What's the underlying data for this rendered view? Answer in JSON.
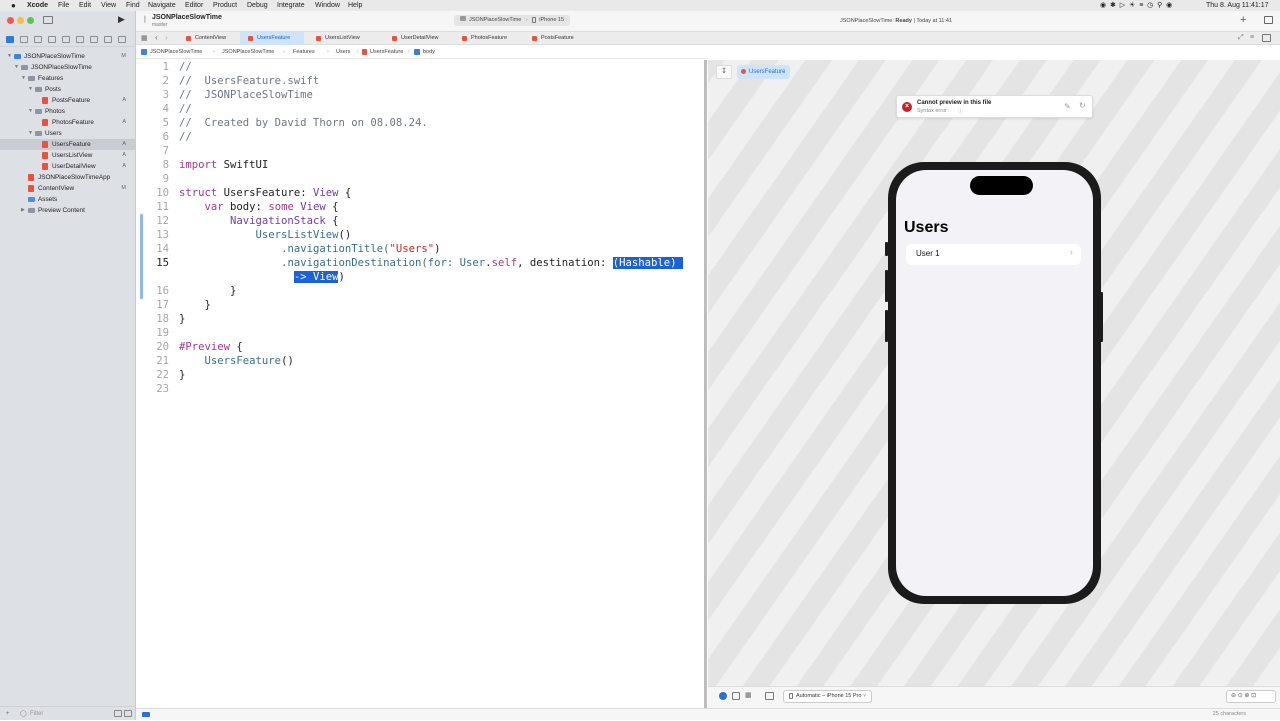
{
  "menubar": {
    "app": "Xcode",
    "items": [
      "File",
      "Edit",
      "View",
      "Find",
      "Navigate",
      "Editor",
      "Product",
      "Debug",
      "Integrate",
      "Window",
      "Help"
    ],
    "clock": "Thu 8. Aug  11:41:17"
  },
  "toolbar": {
    "project_title": "JSONPlaceSlowTime",
    "branch": "master",
    "scheme": "JSONPlaceSlowTime",
    "destination": "iPhone 15",
    "status_prefix": "JSONPlaceSlowTime: ",
    "status_state": "Ready",
    "status_time": " | Today at 11:41"
  },
  "tabs": [
    "ContentView",
    "UsersFeature",
    "UsersListView",
    "UserDetailView",
    "PhotosFeature",
    "PostsFeature"
  ],
  "breadcrumb": [
    "JSONPlaceSlowTime",
    "JSONPlaceSlowTime",
    "Features",
    "Users",
    "UsersFeature",
    "body"
  ],
  "navigator": {
    "items": [
      {
        "label": "JSONPlaceSlowTime",
        "status": "M",
        "kind": "project"
      },
      {
        "label": "JSONPlaceSlowTime",
        "status": "",
        "kind": "folder"
      },
      {
        "label": "Features",
        "status": "",
        "kind": "folder"
      },
      {
        "label": "Posts",
        "status": "",
        "kind": "folder"
      },
      {
        "label": "PostsFeature",
        "status": "A",
        "kind": "swift"
      },
      {
        "label": "Photos",
        "status": "",
        "kind": "folder"
      },
      {
        "label": "PhotosFeature",
        "status": "A",
        "kind": "swift"
      },
      {
        "label": "Users",
        "status": "",
        "kind": "folder"
      },
      {
        "label": "UsersFeature",
        "status": "A",
        "kind": "swift"
      },
      {
        "label": "UsersListView",
        "status": "A",
        "kind": "swift"
      },
      {
        "label": "UserDetailView",
        "status": "A",
        "kind": "swift"
      },
      {
        "label": "JSONPlaceSlowTimeApp",
        "status": "",
        "kind": "swift"
      },
      {
        "label": "ContentView",
        "status": "M",
        "kind": "swift"
      },
      {
        "label": "Assets",
        "status": "",
        "kind": "assets"
      },
      {
        "label": "Preview Content",
        "status": "",
        "kind": "folder"
      }
    ],
    "filter_placeholder": "Filter"
  },
  "editor": {
    "line_numbers": [
      "1",
      "2",
      "3",
      "4",
      "5",
      "6",
      "7",
      "8",
      "9",
      "10",
      "11",
      "12",
      "13",
      "14",
      "15",
      "",
      "16",
      "17",
      "18",
      "19",
      "20",
      "21",
      "22",
      "23"
    ],
    "current_line": "15",
    "code": {
      "l1": "//",
      "l2": "//  UsersFeature.swift",
      "l3": "//  JSONPlaceSlowTime",
      "l4": "//",
      "l5": "//  Created by David Thorn on 08.08.24.",
      "l6": "//",
      "l8a": "import",
      "l8b": " SwiftUI",
      "l10a": "struct",
      "l10b": " UsersFeature: ",
      "l10c": "View",
      "l10d": " {",
      "l11a": "    ",
      "l11b": "var",
      "l11c": " body: ",
      "l11d": "some",
      "l11e": " ",
      "l11f": "View",
      "l11g": " {",
      "l12a": "        ",
      "l12b": "NavigationStack",
      "l12c": " {",
      "l13a": "            ",
      "l13b": "UsersListView",
      "l13c": "()",
      "l14a": "                ",
      "l14b": ".navigationTitle(",
      "l14c": "\"Users\"",
      "l14d": ")",
      "l15a": "                ",
      "l15b": ".navigationDestination(for: ",
      "l15c": "User",
      "l15d": ".",
      "l15e": "self",
      "l15f": ", destination: ",
      "l15g": "(Hashable) ",
      "l15h": "                  ",
      "l15i": "-> View",
      "l15j": ")",
      "l16": "        }",
      "l17": "    }",
      "l18": "}",
      "l20a": "#Preview",
      "l20b": " {",
      "l21a": "    ",
      "l21b": "UsersFeature",
      "l21c": "()",
      "l22": "}"
    }
  },
  "preview": {
    "selector_label": "UsersFeature",
    "error_title": "Cannot preview in this file",
    "error_subtitle": "Syntax error",
    "nav_title": "Users",
    "list_items": [
      "User 1"
    ],
    "device_label": "Automatic – iPhone 15 Pro"
  },
  "statusbar": {
    "char_count": "25 characters"
  },
  "colors": {
    "selection": "#1b62d6",
    "active_tab": "#cfe3fb",
    "error_red": "#d32f2f"
  }
}
